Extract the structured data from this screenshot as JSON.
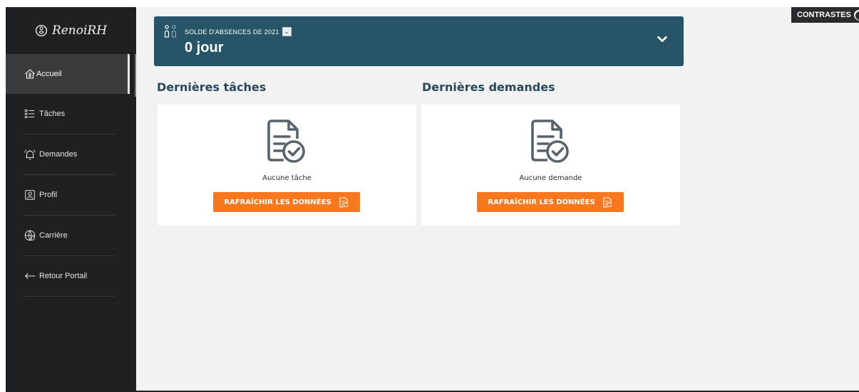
{
  "app": {
    "brand": "RenoiRH",
    "contrast_label": "CONTRASTES"
  },
  "sidebar": {
    "items": [
      {
        "label": "Accueil",
        "icon": "home-icon"
      },
      {
        "label": "Tâches",
        "icon": "tasks-list-icon"
      },
      {
        "label": "Demandes",
        "icon": "bell-icon"
      },
      {
        "label": "Profil",
        "icon": "profile-icon"
      },
      {
        "label": "Carrière",
        "icon": "globe-career-icon"
      },
      {
        "label": "Retour Portail",
        "icon": "arrow-left-icon"
      }
    ]
  },
  "balance": {
    "caption": "SOLDE D'ABSENCES DE 2021",
    "value": "0 jour"
  },
  "sections": {
    "tasks_title": "Dernières tâches",
    "requests_title": "Dernières demandes"
  },
  "tasks_card": {
    "empty_text": "Aucune tâche",
    "button_label": "RAFRAÎCHIR LES DONNÉES"
  },
  "requests_card": {
    "empty_text": "Aucune demande",
    "button_label": "RAFRAÎCHIR LES DONNÉES"
  },
  "colors": {
    "sidebar": "#1f2022",
    "active_nav": "#3a3b3d",
    "balance_banner": "#275467",
    "primary_button": "#f7781e",
    "heading": "#27485d"
  }
}
